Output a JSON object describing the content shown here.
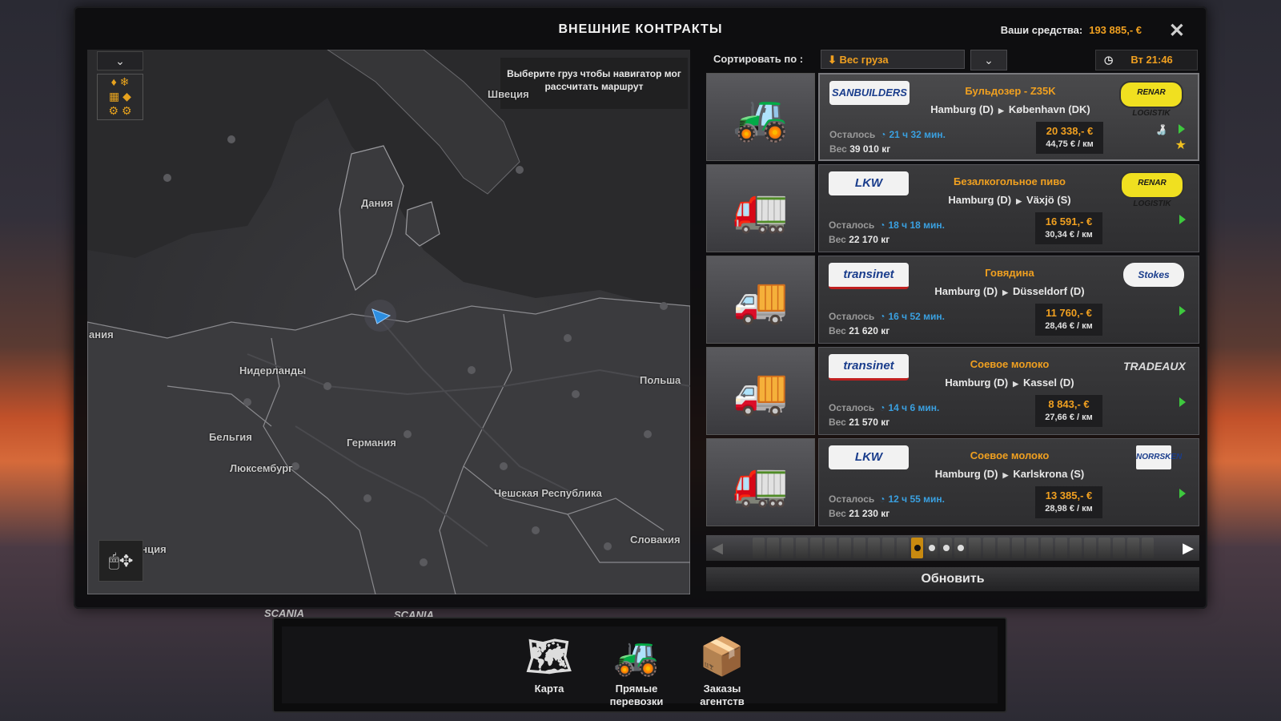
{
  "header": {
    "title": "ВНЕШНИЕ КОНТРАКТЫ",
    "funds_label": "Ваши средства:",
    "funds_value": "193 885,- €",
    "close_icon": "close-icon"
  },
  "map": {
    "hint": "Выберите груз чтобы навигатор мог рассчитать маршрут",
    "labels": [
      "Швеция",
      "Дания",
      "ания",
      "Нидерланды",
      "Бельгия",
      "Люксембург",
      "Германия",
      "Польша",
      "Чешская Республика",
      "Словакия",
      "анция"
    ]
  },
  "sort": {
    "label": "Сортировать по :",
    "value": "Вес груза"
  },
  "clock": {
    "time": "Вт 21:46"
  },
  "jobs": [
    {
      "company": "SANBUILDERS",
      "cargo": "Бульдозер - Z35K",
      "from": "Hamburg (D)",
      "to": "København (DK)",
      "dest": "RENAR LOGISTIK",
      "left_label": "Осталось",
      "time": "21 ч 32 мин.",
      "weight_label": "Вес",
      "weight": "39 010 кг",
      "pay": "20 338,- €",
      "per_km": "44,75 € / км",
      "selected": true
    },
    {
      "company": "LKW",
      "cargo": "Безалкогольное пиво",
      "from": "Hamburg (D)",
      "to": "Växjö (S)",
      "dest": "RENAR LOGISTIK",
      "left_label": "Осталось",
      "time": "18 ч 18 мин.",
      "weight_label": "Вес",
      "weight": "22 170 кг",
      "pay": "16 591,- €",
      "per_km": "30,34 € / км"
    },
    {
      "company": "transinet",
      "cargo": "Говядина",
      "from": "Hamburg (D)",
      "to": "Düsseldorf (D)",
      "dest": "Stokes",
      "left_label": "Осталось",
      "time": "16 ч 52 мин.",
      "weight_label": "Вес",
      "weight": "21 620 кг",
      "pay": "11 760,- €",
      "per_km": "28,46 € / км"
    },
    {
      "company": "transinet",
      "cargo": "Соевое молоко",
      "from": "Hamburg (D)",
      "to": "Kassel (D)",
      "dest": "TRADEAUX",
      "left_label": "Осталось",
      "time": "14 ч 6 мин.",
      "weight_label": "Вес",
      "weight": "21 570 кг",
      "pay": "8 843,- €",
      "per_km": "27,66 € / км"
    },
    {
      "company": "LKW",
      "cargo": "Соевое молоко",
      "from": "Hamburg (D)",
      "to": "Karlskrona (S)",
      "dest": "NORRSKEN",
      "left_label": "Осталось",
      "time": "12 ч 55 мин.",
      "weight_label": "Вес",
      "weight": "21 230 кг",
      "pay": "13 385,- €",
      "per_km": "28,98 € / км"
    }
  ],
  "refresh_label": "Обновить",
  "bottom": {
    "map_label": "Карта",
    "direct_label_1": "Прямые",
    "direct_label_2": "перевозки",
    "agent_label_1": "Заказы",
    "agent_label_2": "агентств"
  },
  "brands": {
    "b1": "SCANIA",
    "b2": "SCANIA"
  }
}
